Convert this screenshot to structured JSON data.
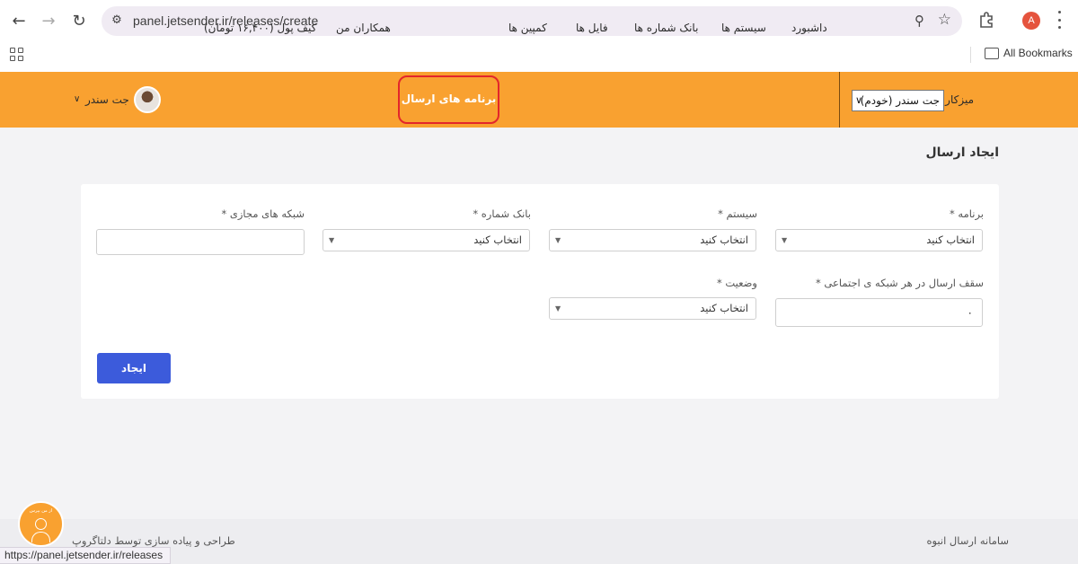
{
  "browser": {
    "url": "panel.jetsender.ir/releases/create",
    "profile_initial": "A",
    "bookmarks_label": "All Bookmarks",
    "status_url": "https://panel.jetsender.ir/releases"
  },
  "topnav": {
    "workspace_label": "میزکار",
    "workspace_selected": "جت سندر (خودم)",
    "items": [
      "داشبورد",
      "سیستم ها",
      "بانک شماره ها",
      "فایل ها",
      "کمپین ها",
      "برنامه های ارسال",
      "همکاران من",
      "کیف پول (۱۶,۴۰۰ تومان)"
    ],
    "user_name": "جت سندر"
  },
  "page": {
    "title": "ایجاد ارسال",
    "fields": {
      "program": {
        "label": "برنامه *",
        "value": "انتخاب کنید"
      },
      "system": {
        "label": "سیستم *",
        "value": "انتخاب کنید"
      },
      "number_bank": {
        "label": "بانک شماره *",
        "value": "انتخاب کنید"
      },
      "virtual_networks": {
        "label": "شبکه های مجازی *",
        "value": ""
      },
      "send_limit": {
        "label": "سقف ارسال در هر شبکه ی اجتماعی *",
        "value": "۰"
      },
      "status": {
        "label": "وضعیت *",
        "value": "انتخاب کنید"
      }
    },
    "submit_label": "ایجاد"
  },
  "footer": {
    "right_text": "سامانه ارسال انبوه",
    "left_text": "طراحی و پیاده سازی توسط دلتاگروپ",
    "support_text": "از من بپرس"
  },
  "colors": {
    "nav_bg": "#f9a130",
    "active_outline": "#e3262b",
    "primary_button": "#3c5bdb"
  }
}
